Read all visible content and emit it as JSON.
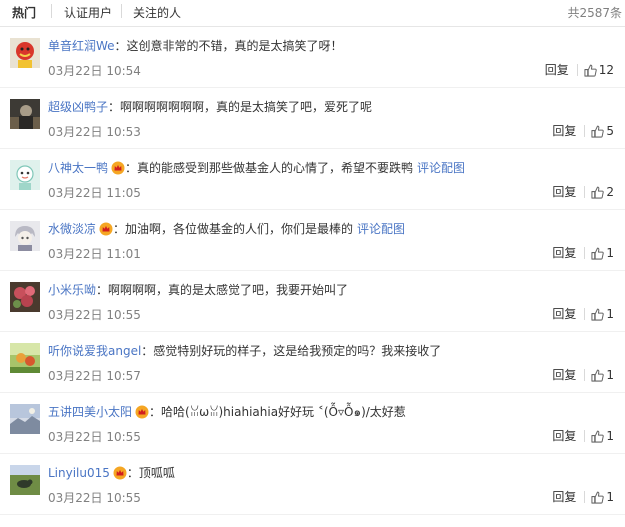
{
  "tabs": [
    {
      "label": "热门",
      "active": true
    },
    {
      "label": "认证用户",
      "active": false
    },
    {
      "label": "关注的人",
      "active": false
    }
  ],
  "total": "共2587条",
  "comments": [
    {
      "user": "单音红润We",
      "vip": false,
      "text": "：这创意非常的不错，真的是太搞笑了呀！",
      "link": "",
      "time": "03月22日 10:54",
      "reply": "回复",
      "likes": "12",
      "avatar": "avatar-red-mascot"
    },
    {
      "user": "超级凶鸭子",
      "vip": false,
      "text": "：啊啊啊啊啊啊啊，真的是太搞笑了吧，爱死了呢",
      "link": "",
      "time": "03月22日 10:53",
      "reply": "回复",
      "likes": "5",
      "avatar": "avatar-dark-photo"
    },
    {
      "user": "八神太一鸭",
      "vip": true,
      "text": "：真的能感受到那些做基金人的心情了，希望不要跌鸭",
      "link": "评论配图",
      "time": "03月22日 11:05",
      "reply": "回复",
      "likes": "2",
      "avatar": "avatar-cartoon"
    },
    {
      "user": "水微淡凉",
      "vip": true,
      "text": "：加油啊，各位做基金的人们，你们是最棒的",
      "link": "评论配图",
      "time": "03月22日 11:01",
      "reply": "回复",
      "likes": "1",
      "avatar": "avatar-anime"
    },
    {
      "user": "小米乐呦",
      "vip": false,
      "text": "：啊啊啊啊，真的是太感觉了吧，我要开始叫了",
      "link": "",
      "time": "03月22日 10:55",
      "reply": "回复",
      "likes": "1",
      "avatar": "avatar-flowers"
    },
    {
      "user": "听你说爱我angel",
      "vip": false,
      "text": "：感觉特别好玩的样子，这是给我预定的吗？我来接收了",
      "link": "",
      "time": "03月22日 10:57",
      "reply": "回复",
      "likes": "1",
      "avatar": "avatar-green"
    },
    {
      "user": "五讲四美小太阳",
      "vip": true,
      "text": "：哈哈(ꈍωꈍ)hiahiahia好好玩 ˂(Ỗ▿Ỗ๑)/太好惹",
      "link": "",
      "time": "03月22日 10:55",
      "reply": "回复",
      "likes": "1",
      "avatar": "avatar-landscape"
    },
    {
      "user": "Linyilu015",
      "vip": true,
      "text": "：顶呱呱",
      "link": "",
      "time": "03月22日 10:55",
      "reply": "回复",
      "likes": "1",
      "avatar": "avatar-field"
    }
  ],
  "colors": {
    "link": "#4a75c4",
    "muted": "#808080",
    "badge": "#f5a623"
  }
}
